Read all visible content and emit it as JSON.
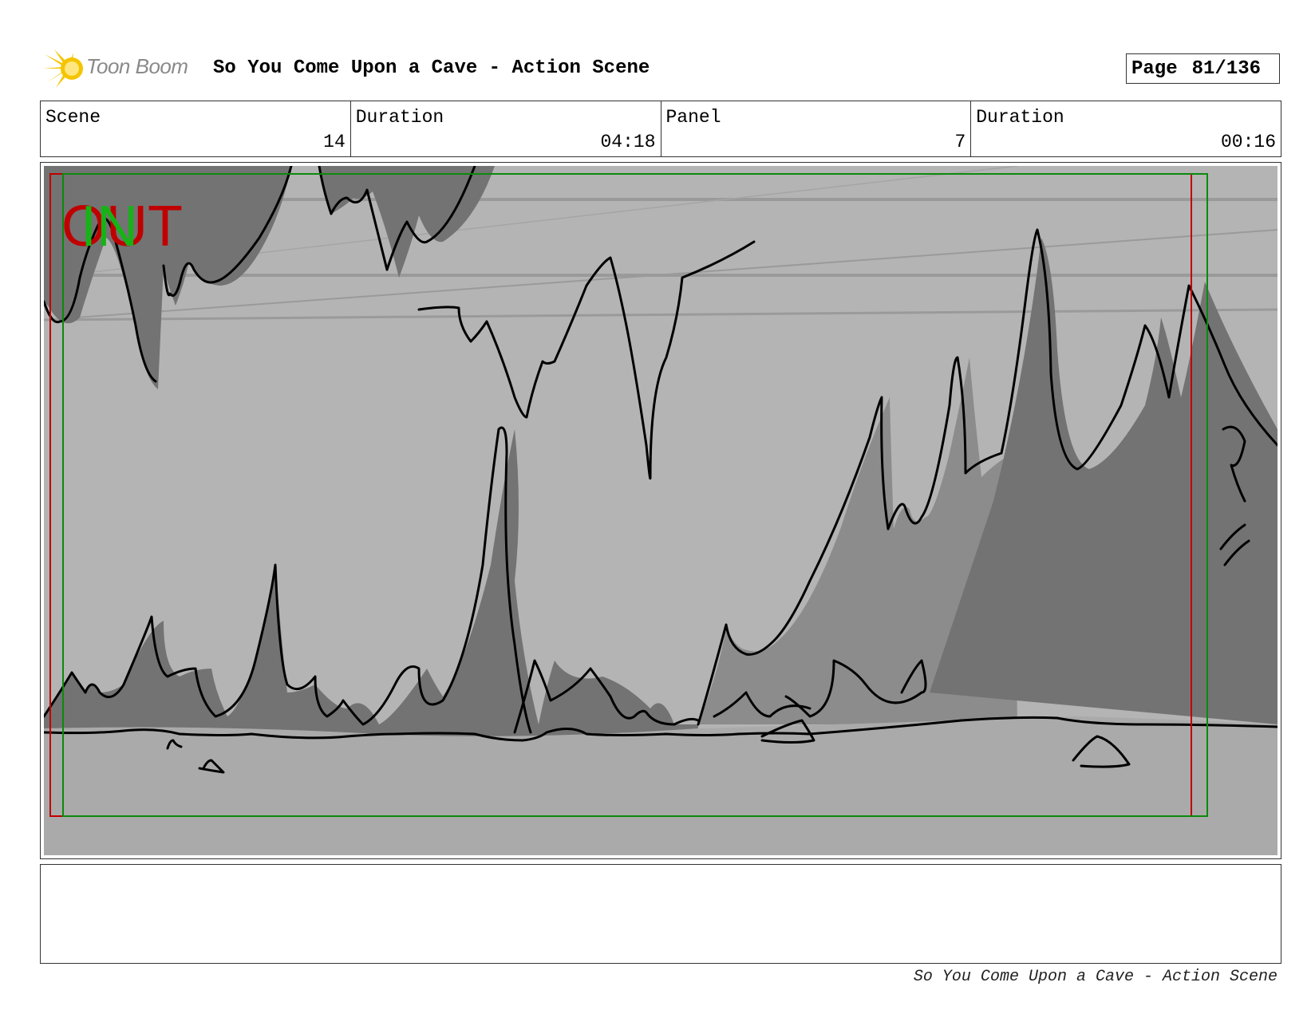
{
  "header": {
    "logo_text": "Toon Boom",
    "title": "So You Come Upon a Cave - Action Scene",
    "page_label": "Page",
    "page_number": "81/136"
  },
  "info": [
    {
      "label": "Scene",
      "value": "14"
    },
    {
      "label": "Duration",
      "value": "04:18"
    },
    {
      "label": "Panel",
      "value": "7"
    },
    {
      "label": "Duration",
      "value": "00:16"
    }
  ],
  "panel": {
    "overlay_out": "OUT",
    "overlay_in": "IN",
    "colors": {
      "sky": "#b4b4b4",
      "mid_rock": "#8c8c8c",
      "dark_rock": "#737373",
      "ground": "#aaaaaa",
      "frame_red": "#c00000",
      "frame_green": "#0b8a0b",
      "logo_yellow": "#f5c400"
    }
  },
  "notes": "",
  "footer": {
    "text": "So You Come Upon a Cave - Action Scene"
  }
}
